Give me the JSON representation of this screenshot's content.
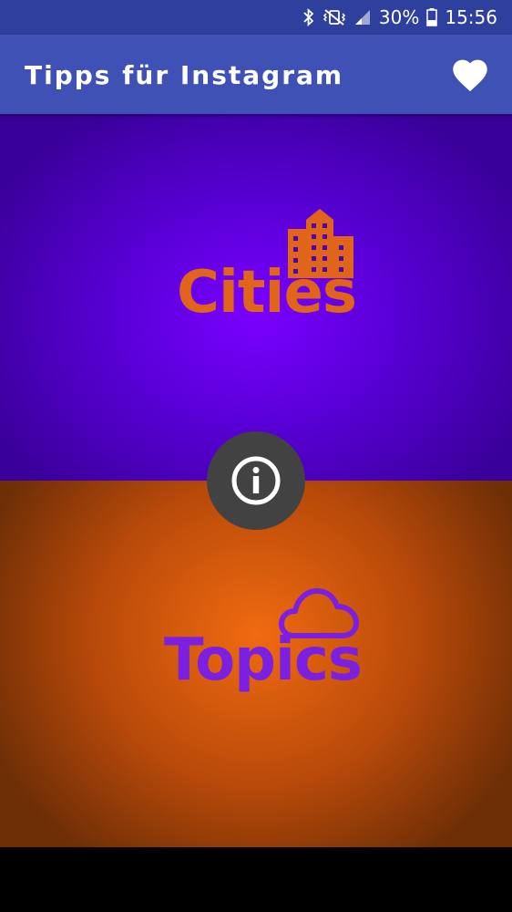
{
  "status_bar": {
    "battery": "30%",
    "time": "15:56",
    "icons": [
      "bluetooth-icon",
      "vibrate-mute-icon",
      "signal-icon",
      "battery-icon"
    ]
  },
  "app_bar": {
    "title": "Tipps für Instagram",
    "favorite_icon": "heart-icon"
  },
  "panels": {
    "cities": {
      "label": "Cities",
      "icon": "city-buildings-icon",
      "color": "#e0651a"
    },
    "topics": {
      "label": "Topics",
      "icon": "cloud-icon",
      "color": "#7b1fe0"
    }
  },
  "info_button": {
    "icon": "info-icon"
  },
  "colors": {
    "status_bar": "#2e3f9e",
    "app_bar": "#3f51b5",
    "cities_bg": "#6200ea",
    "topics_bg": "#e65100",
    "info_button": "#424242"
  }
}
